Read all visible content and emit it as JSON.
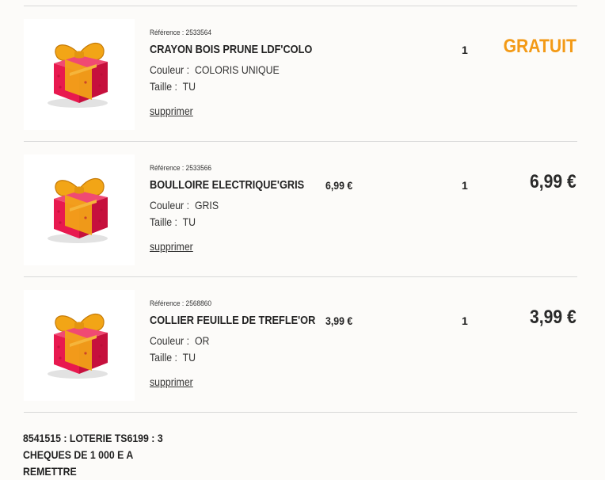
{
  "cart": {
    "items": [
      {
        "reference": "Référence : 2533564",
        "name": "CRAYON BOIS PRUNE LDF'COLO",
        "color_label": "Couleur :",
        "color_value": "COLORIS UNIQUE",
        "size_label": "Taille :",
        "size_value": "TU",
        "remove_label": "supprimer",
        "unit_price": "",
        "quantity": "1",
        "total": "GRATUIT",
        "image_icon": "gift-box-icon"
      },
      {
        "reference": "Référence : 2533566",
        "name": "BOULLOIRE ELECTRIQUE'GRIS",
        "color_label": "Couleur :",
        "color_value": "GRIS",
        "size_label": "Taille :",
        "size_value": "TU",
        "remove_label": "supprimer",
        "unit_price": "6,99 €",
        "quantity": "1",
        "total": "6,99 €",
        "image_icon": "gift-box-icon"
      },
      {
        "reference": "Référence : 2568860",
        "name": "COLLIER FEUILLE DE TREFLE'OR",
        "color_label": "Couleur :",
        "color_value": "OR",
        "size_label": "Taille :",
        "size_value": "TU",
        "remove_label": "supprimer",
        "unit_price": "3,99 €",
        "quantity": "1",
        "total": "3,99 €",
        "image_icon": "gift-box-icon"
      }
    ],
    "footer_note": [
      "8541515 : LOTERIE TS6199 : 3",
      "CHEQUES DE 1 000 E A",
      "REMETTRE"
    ]
  },
  "colors": {
    "free_price": "#f39a16",
    "gift_box": "#e8194f",
    "ribbon": "#f2a516",
    "divider": "#d8d8d8",
    "background": "#fcfbf9"
  }
}
